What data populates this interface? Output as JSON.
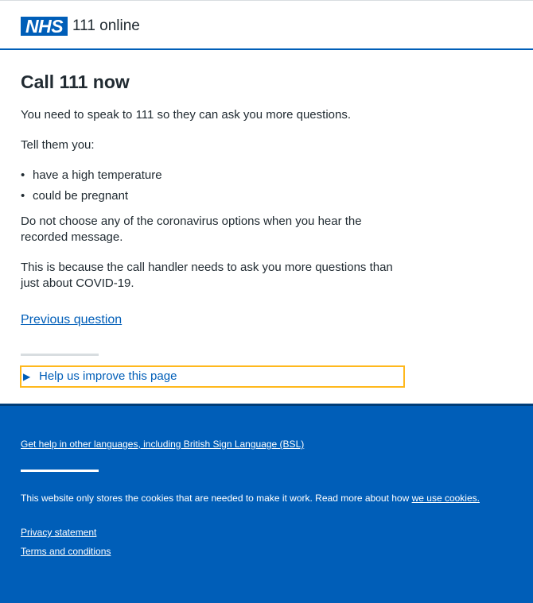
{
  "header": {
    "logo_text": "NHS",
    "service_name": "111 online"
  },
  "main": {
    "title": "Call 111 now",
    "intro": "You need to speak to 111 so they can ask you more questions.",
    "tell_them": "Tell them you:",
    "bullets": [
      "have a high temperature",
      "could be pregnant"
    ],
    "warning": "Do not choose any of the coronavirus options when you hear the recorded message.",
    "reason": "This is because the call handler needs to ask you more questions than just about COVID-19.",
    "previous_link": "Previous question",
    "feedback_summary": "Help us improve this page"
  },
  "footer": {
    "languages_link": "Get help in other languages, including British Sign Language (BSL)",
    "cookies_text": "This website only stores the cookies that are needed to make it work. Read more about how ",
    "cookies_link": "we use cookies.",
    "privacy_link": "Privacy statement",
    "terms_link": "Terms and conditions"
  },
  "colors": {
    "nhs_blue": "#005eb8",
    "focus_yellow": "#ffb81c",
    "text": "#212b32"
  }
}
